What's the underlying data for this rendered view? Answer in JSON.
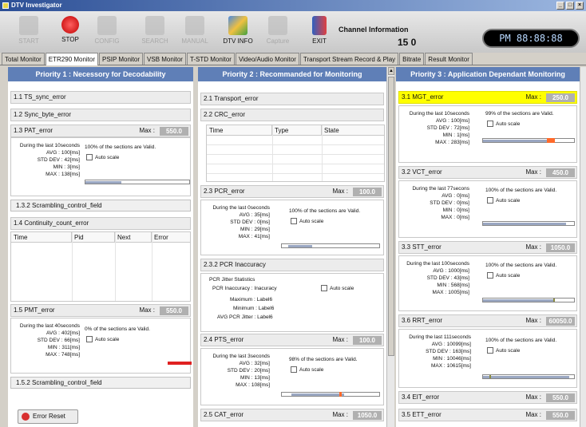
{
  "window": {
    "title": "DTV Investigator"
  },
  "toolbar": {
    "buttons": [
      {
        "label": "START",
        "icon": "monitor-icon",
        "enabled": false
      },
      {
        "label": "STOP",
        "icon": "stop-icon",
        "enabled": true
      },
      {
        "label": "CONFIG",
        "icon": "config-icon",
        "enabled": false
      },
      {
        "label": "SEARCH",
        "icon": "search-icon",
        "enabled": false
      },
      {
        "label": "MANUAL",
        "icon": "manual-icon",
        "enabled": false
      },
      {
        "label": "DTV INFO",
        "icon": "tv-info-icon",
        "enabled": true
      },
      {
        "label": "Capture",
        "icon": "capture-icon",
        "enabled": false
      },
      {
        "label": "EXIT",
        "icon": "exit-icon",
        "enabled": true
      }
    ],
    "channel_info_label": "Channel Information",
    "channel_number": "15 0",
    "clock": "PM 88:88:88"
  },
  "tabs": [
    "Total Monitor",
    "ETR290 Monitor",
    "PSIP Monitor",
    "VSB Monitor",
    "T-STD Monitor",
    "Video/Audio Monitor",
    "Transport Stream Record & Play",
    "Bitrate",
    "Result Monitor"
  ],
  "active_tab": "ETR290 Monitor",
  "p1": {
    "title": "Priority 1 : Necessory for Decodability",
    "ts_sync": "1.1 TS_sync_error",
    "sync_byte": "1.2 Sync_byte_error",
    "pat": {
      "name": "1.3 PAT_error",
      "max_label": "Max :",
      "max": "550.0",
      "during": "During the last 10seconds",
      "avg": "100[ms]",
      "std": "42[ms]",
      "min": "3[ms]",
      "max_v": "138[ms]",
      "valid": "100% of the sections are Valid."
    },
    "scr1": "1.3.2 Scrambling_control_field",
    "cc": {
      "name": "1.4 Continuity_count_error",
      "cols": [
        "Time",
        "Pid",
        "Next",
        "Error"
      ]
    },
    "pmt": {
      "name": "1.5 PMT_error",
      "max_label": "Max :",
      "max": "550.0",
      "during": "During the last 40seconds",
      "avg": "402[ms]",
      "std": "66[ms]",
      "min": "311[ms]",
      "max_v": "748[ms]",
      "valid": "0% of the sections are Valid."
    },
    "scr2": "1.5.2 Scrambling_control_field",
    "error_reset": "Error Reset"
  },
  "p2": {
    "title": "Priority 2 : Recommanded for Monitoring",
    "transport": "2.1 Transport_error",
    "crc": {
      "name": "2.2 CRC_error",
      "cols": [
        "Time",
        "Type",
        "State"
      ]
    },
    "pcr": {
      "name": "2.3 PCR_error",
      "max_label": "Max :",
      "max": "100.0",
      "during": "During the last 0seconds",
      "avg": "35[ms]",
      "std": "0[ms]",
      "min": "29[ms]",
      "max_v": "41[ms]",
      "valid": "100% of the sections are Valid."
    },
    "pcr_inacc": {
      "name": "2.3.2 PCR Inaccuracy",
      "stats": "PCR Jitter Statistics",
      "inacc_label": "PCR Inaccuracy :",
      "inacc_val": "Inacuracy",
      "max_label": "Maximum :",
      "max_val": "Label6",
      "min_label": "Minimum :",
      "min_val": "Label6",
      "avg_label": "AVG PCR Jitter :",
      "avg_val": "Label6"
    },
    "pts": {
      "name": "2.4 PTS_error",
      "max_label": "Max :",
      "max": "100.0",
      "during": "During the last 3seconds",
      "avg": "32[ms]",
      "std": "20[ms]",
      "min": "13[ms]",
      "max_v": "108[ms]",
      "valid": "98% of the sections are Valid."
    },
    "cat": {
      "name": "2.5 CAT_error",
      "max_label": "Max :",
      "max": "1050.0"
    }
  },
  "p3": {
    "title": "Priority 3 : Application Dependant Monitoring",
    "mgt": {
      "name": "3.1 MGT_error",
      "max_label": "Max :",
      "max": "250.0",
      "during": "During the last 10seconds",
      "avg": "100[ms]",
      "std": "72[ms]",
      "min": "1[ms]",
      "max_v": "283[ms]",
      "valid": "99% of the sections are Valid."
    },
    "vct": {
      "name": "3.2 VCT_error",
      "max_label": "Max :",
      "max": "450.0",
      "during": "During the last 77secons",
      "avg": "0[ms]",
      "std": "0[ms]",
      "min": "0[ms]",
      "max_v": "0[ms]",
      "valid": "100% of the sections are Valid."
    },
    "stt": {
      "name": "3.3 STT_error",
      "max_label": "Max :",
      "max": "1050.0",
      "during": "During the last 100seconds",
      "avg": "1000[ms]",
      "std": "43[ms]",
      "min": "568[ms]",
      "max_v": "1005[ms]",
      "valid": "100% of the sections are Valid."
    },
    "rrt": {
      "name": "3.6 RRT_error",
      "max_label": "Max :",
      "max": "60050.0",
      "during": "During the last 111seconds",
      "avg": "10099[ms]",
      "std": "163[ms]",
      "min": "10046[ms]",
      "max_v": "10615[ms]",
      "valid": "100% of the sections are Valid."
    },
    "eit": {
      "name": "3.4 EIT_error",
      "max_label": "Max :",
      "max": "550.0"
    },
    "ett": {
      "name": "3.5 ETT_error",
      "max_label": "Max :",
      "max": "550.0"
    }
  },
  "labels": {
    "avg": "AVG :",
    "std": "STD DEV :",
    "min": "MIN :",
    "max": "MAX :",
    "auto_scale": "Auto scale"
  }
}
